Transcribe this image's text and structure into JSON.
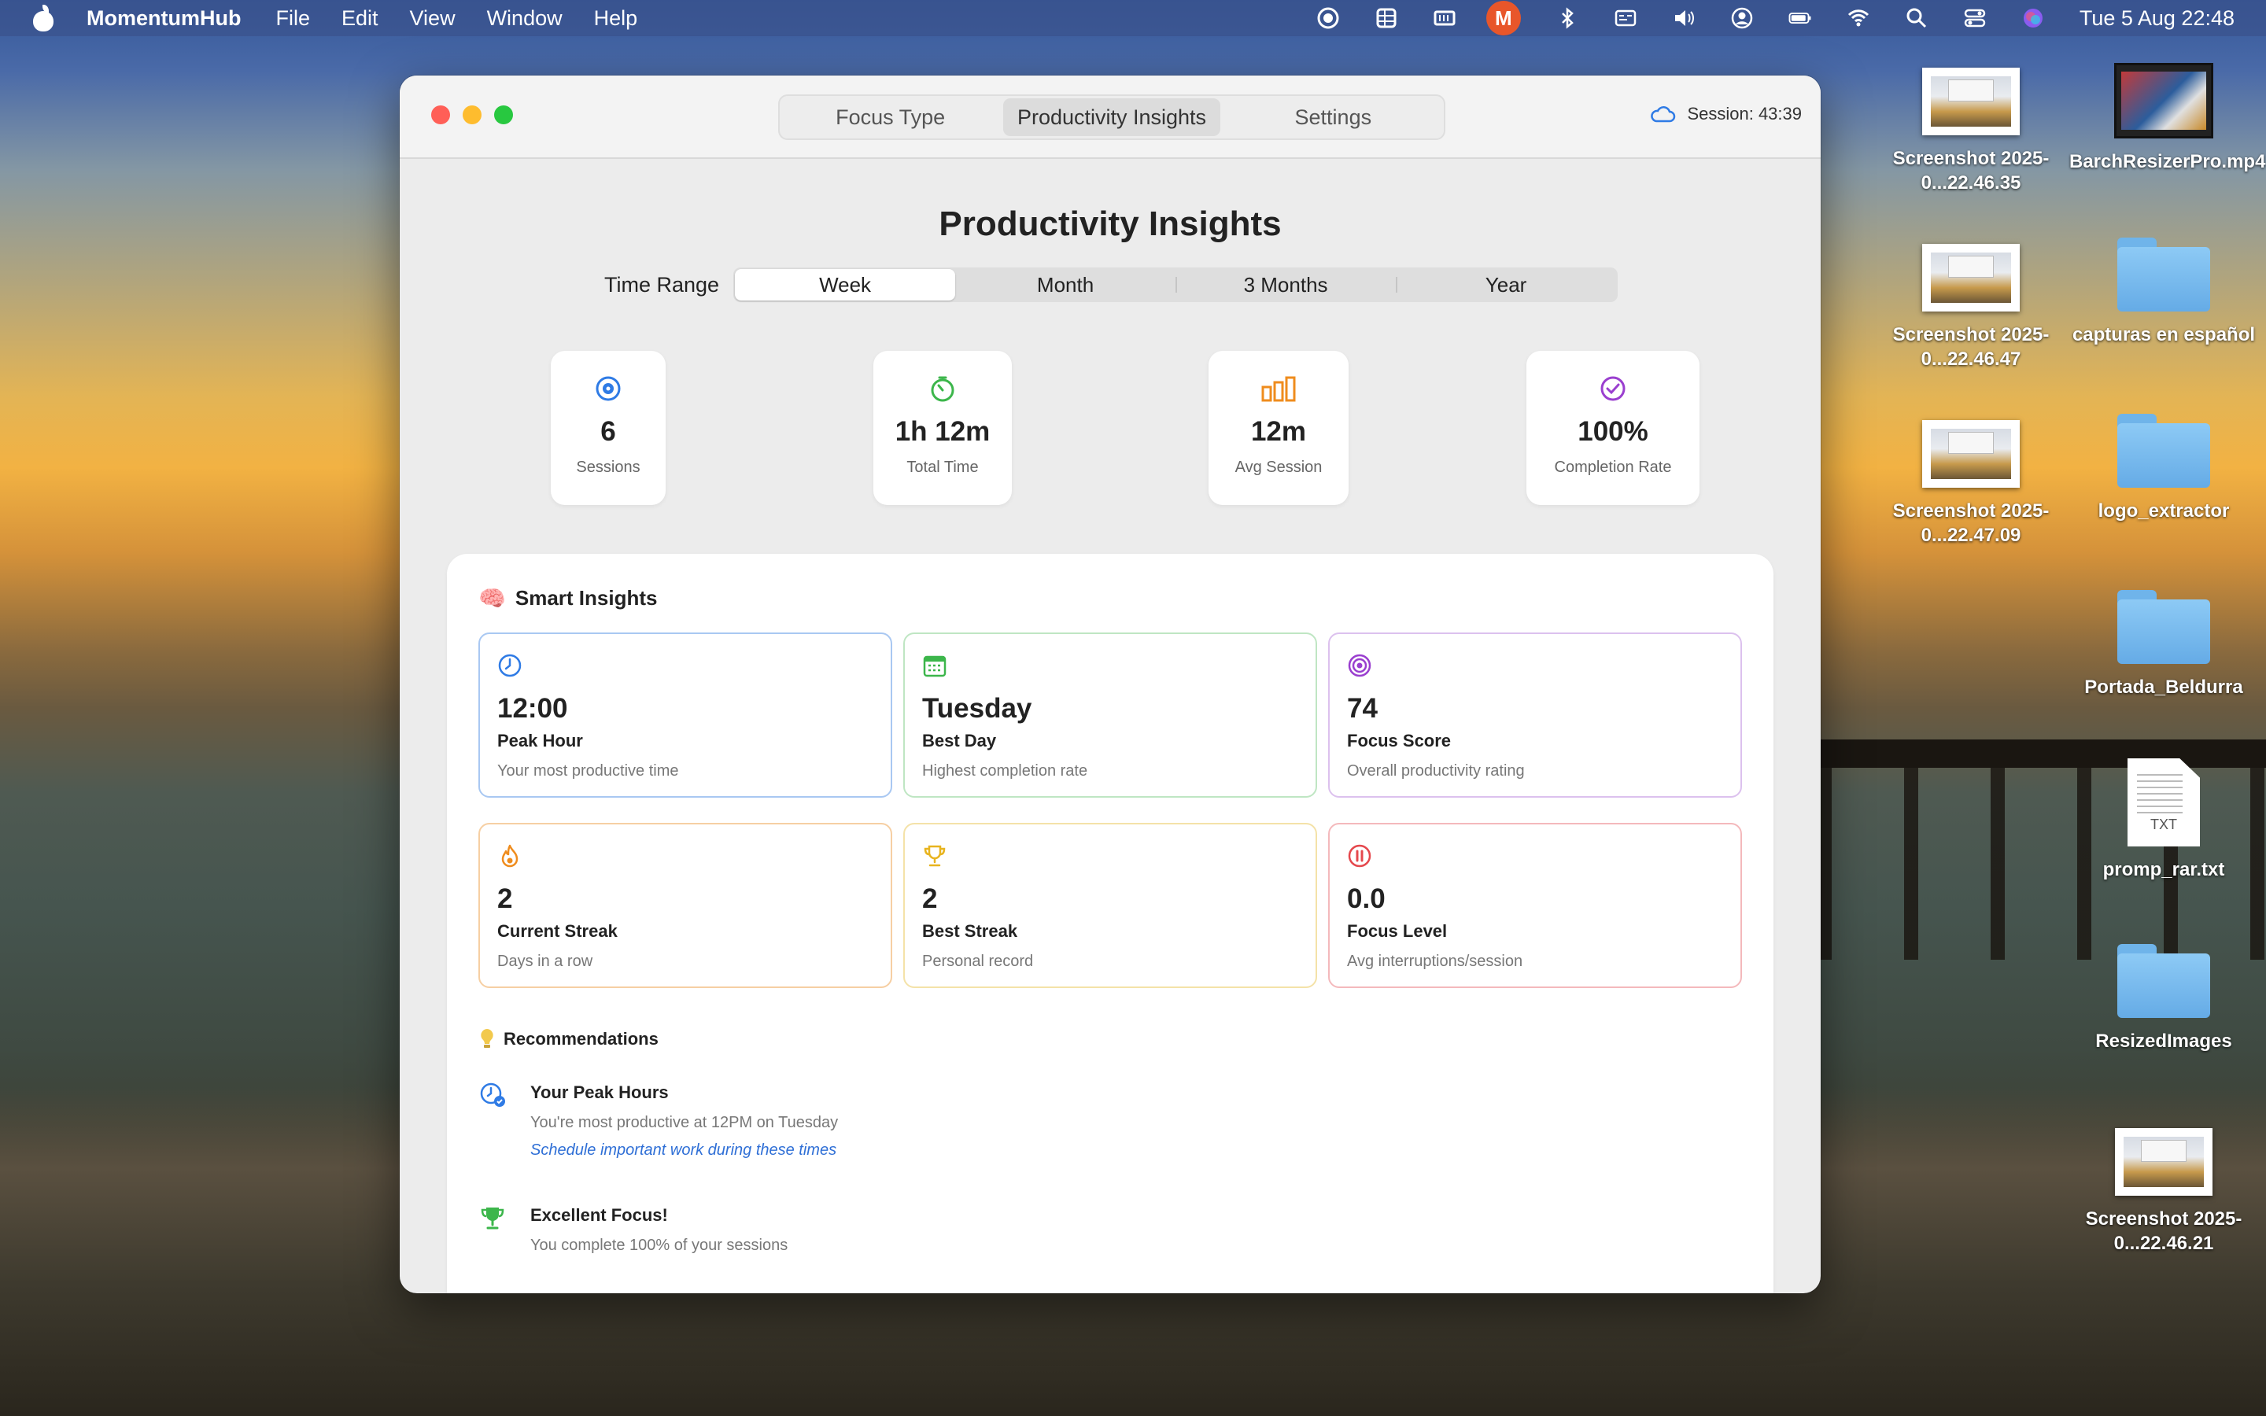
{
  "menubar": {
    "app_name": "MomentumHub",
    "items": [
      "File",
      "Edit",
      "View",
      "Window",
      "Help"
    ],
    "status_app_glyph": "M",
    "clock": "Tue 5 Aug  22:48"
  },
  "desktop": {
    "icons": [
      {
        "label": "Screenshot 2025-0...22.46.35",
        "kind": "screenshot"
      },
      {
        "label": "BarchResizerPro.mp4",
        "kind": "video"
      },
      {
        "label": "Screenshot 2025-0...22.46.47",
        "kind": "screenshot"
      },
      {
        "label": "capturas en español",
        "kind": "folder"
      },
      {
        "label": "Screenshot 2025-0...22.47.09",
        "kind": "screenshot"
      },
      {
        "label": "logo_extractor",
        "kind": "folder"
      },
      {
        "label": "Portada_Beldurra",
        "kind": "folder"
      },
      {
        "label": "promp_rar.txt",
        "kind": "txt",
        "badge": "TXT"
      },
      {
        "label": "ResizedImages",
        "kind": "folder"
      },
      {
        "label": "Screenshot 2025-0...22.46.21",
        "kind": "screenshot"
      }
    ]
  },
  "window": {
    "tabs": [
      "Focus Type",
      "Productivity Insights",
      "Settings"
    ],
    "active_tab": "Productivity Insights",
    "session": "Session: 43:39"
  },
  "page": {
    "title": "Productivity Insights",
    "time_range_label": "Time Range",
    "ranges": [
      "Week",
      "Month",
      "3 Months",
      "Year"
    ],
    "selected_range": "Week"
  },
  "stats": [
    {
      "value": "6",
      "label": "Sessions",
      "icon": "target-icon",
      "color": "#2f7be5"
    },
    {
      "value": "1h 12m",
      "label": "Total Time",
      "icon": "timer-icon",
      "color": "#3cb64b"
    },
    {
      "value": "12m",
      "label": "Avg Session",
      "icon": "bar-chart-icon",
      "color": "#ef8c1d"
    },
    {
      "value": "100%",
      "label": "Completion Rate",
      "icon": "checkmark-circle-icon",
      "color": "#9a3fcf"
    }
  ],
  "smart_insights": {
    "title": "Smart Insights",
    "cards": [
      {
        "value": "12:00",
        "title": "Peak Hour",
        "subtitle": "Your most productive time",
        "icon": "clock-icon",
        "color": "#2f7be5"
      },
      {
        "value": "Tuesday",
        "title": "Best Day",
        "subtitle": "Highest completion rate",
        "icon": "calendar-icon",
        "color": "#3cb64b"
      },
      {
        "value": "74",
        "title": "Focus Score",
        "subtitle": "Overall productivity rating",
        "icon": "target-icon",
        "color": "#9a3fcf"
      },
      {
        "value": "2",
        "title": "Current Streak",
        "subtitle": "Days in a row",
        "icon": "flame-icon",
        "color": "#ef8c1d"
      },
      {
        "value": "2",
        "title": "Best Streak",
        "subtitle": "Personal record",
        "icon": "trophy-icon",
        "color": "#e8b41f"
      },
      {
        "value": "0.0",
        "title": "Focus Level",
        "subtitle": "Avg interruptions/session",
        "icon": "pause-circle-icon",
        "color": "#e5484d"
      }
    ]
  },
  "recommendations": {
    "title": "Recommendations",
    "items": [
      {
        "title": "Your Peak Hours",
        "body": "You're most productive at 12PM on Tuesday",
        "action": "Schedule important work during these times",
        "icon": "clock-badge-icon",
        "color": "#2f7be5"
      },
      {
        "title": "Excellent Focus!",
        "body": "You complete 100% of your sessions",
        "action": "",
        "icon": "trophy-icon",
        "color": "#3cb64b"
      }
    ]
  }
}
